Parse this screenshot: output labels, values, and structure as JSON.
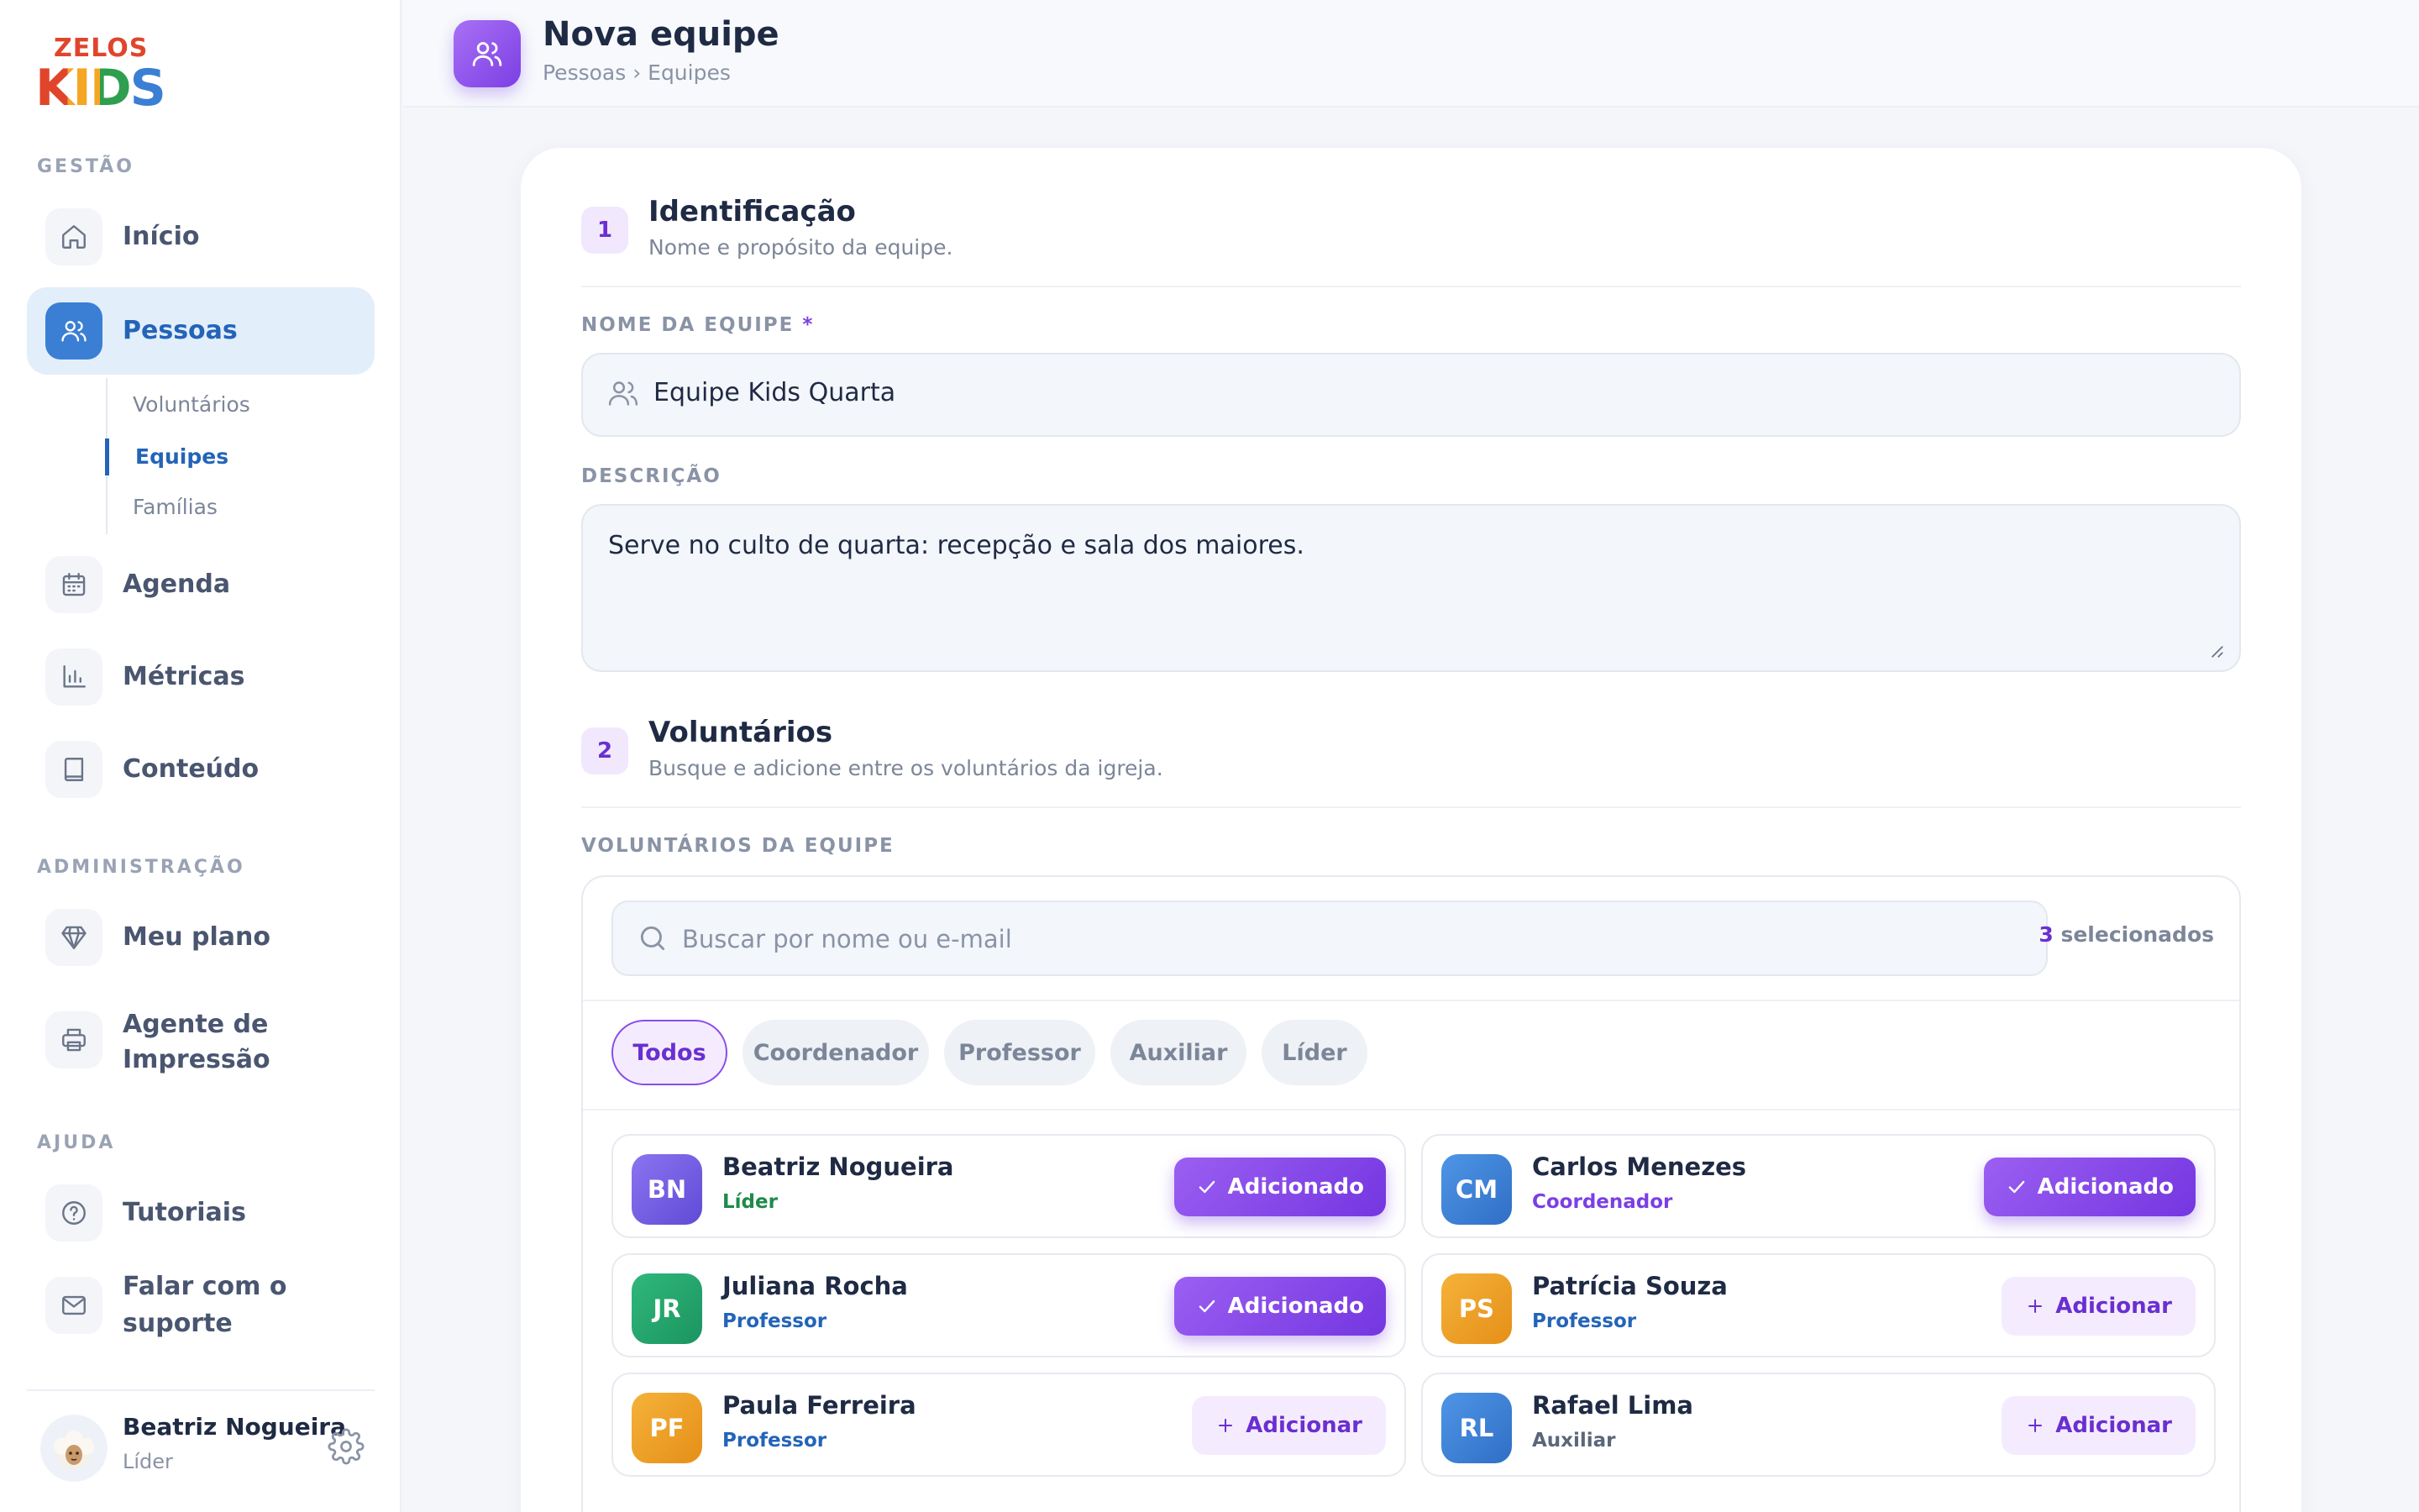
{
  "brand": {
    "logo_top": "ZELOS",
    "logo_bottom": "KIDS"
  },
  "sidebar": {
    "section_gestao": "GESTÃO",
    "section_admin": "ADMINISTRAÇÃO",
    "section_ajuda": "AJUDA",
    "items": {
      "inicio": "Início",
      "pessoas": "Pessoas",
      "agenda": "Agenda",
      "metricas": "Métricas",
      "conteudo": "Conteúdo",
      "meu_plano": "Meu plano",
      "agente_line1": "Agente de",
      "agente_line2": "Impressão",
      "tutoriais": "Tutoriais",
      "suporte": "Falar com o suporte"
    },
    "subnav": {
      "voluntarios": "Voluntários",
      "equipes": "Equipes",
      "familias": "Famílias"
    },
    "user": {
      "name": "Beatriz Nogueira",
      "role": "Líder"
    }
  },
  "header": {
    "title": "Nova equipe",
    "breadcrumb": "Pessoas › Equipes"
  },
  "form": {
    "step1": {
      "number": "1",
      "title": "Identificação",
      "subtitle": "Nome e propósito da equipe."
    },
    "team_name_label": "NOME DA EQUIPE",
    "required_mark": "*",
    "team_name_value": "Equipe Kids Quarta",
    "description_label": "DESCRIÇÃO",
    "description_value": "Serve no culto de quarta: recepção e sala dos maiores.",
    "step2": {
      "number": "2",
      "title": "Voluntários",
      "subtitle": "Busque e adicione entre os voluntários da igreja."
    },
    "volunteers_label": "VOLUNTÁRIOS DA EQUIPE",
    "search_placeholder": "Buscar por nome ou e-mail",
    "selected_count": "3",
    "selected_suffix": "selecionados",
    "filters": [
      "Todos",
      "Coordenador",
      "Professor",
      "Auxiliar",
      "Líder"
    ],
    "added_label": "Adicionado",
    "add_label": "Adicionar",
    "volunteers": [
      {
        "initials": "BN",
        "name": "Beatriz Nogueira",
        "role": "Líder",
        "added": true
      },
      {
        "initials": "CM",
        "name": "Carlos Menezes",
        "role": "Coordenador",
        "added": true
      },
      {
        "initials": "JR",
        "name": "Juliana Rocha",
        "role": "Professor",
        "added": true
      },
      {
        "initials": "PS",
        "name": "Patrícia Souza",
        "role": "Professor",
        "added": false
      },
      {
        "initials": "PF",
        "name": "Paula Ferreira",
        "role": "Professor",
        "added": false
      },
      {
        "initials": "RL",
        "name": "Rafael Lima",
        "role": "Auxiliar",
        "added": false
      }
    ]
  },
  "colors": {
    "accent": "#7b3fe4",
    "primary_blue": "#2364b8",
    "role_lider": "#1e8a4a",
    "role_coordenador": "#7b3fe4",
    "role_professor": "#2364b8",
    "role_auxiliar": "#5b667a"
  }
}
